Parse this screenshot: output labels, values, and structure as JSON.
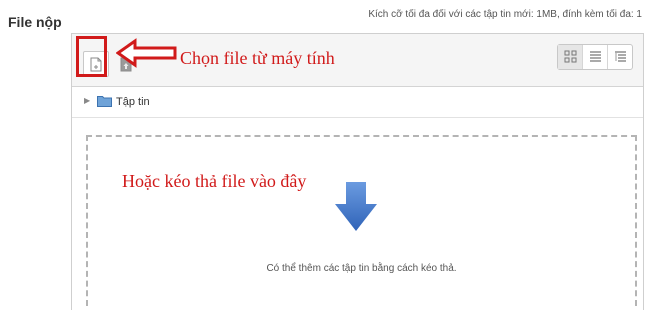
{
  "field": {
    "label": "File nộp",
    "limits": "Kích cỡ tối đa đối với các tập tin mới: 1MB, đính kèm tối đa: 1"
  },
  "toolbar": {
    "add_file_icon": "add-file-icon",
    "upload_icon": "upload-file-icon",
    "view_icons": [
      "view-icons-icon",
      "view-list-icon",
      "view-tree-icon"
    ]
  },
  "path": {
    "folder_label": "Tập tin"
  },
  "drop_zone": {
    "instruction": "Có thể thêm các tập tin bằng cách kéo thả."
  },
  "annotations": {
    "choose_file": "Chọn file từ máy tính",
    "drag_drop": "Hoặc kéo thả file vào đây",
    "color": "#d11a1a"
  },
  "colors": {
    "drop_arrow": "#3f75c9",
    "folder": "#6fa3d8",
    "highlight": "#d11a1a"
  }
}
